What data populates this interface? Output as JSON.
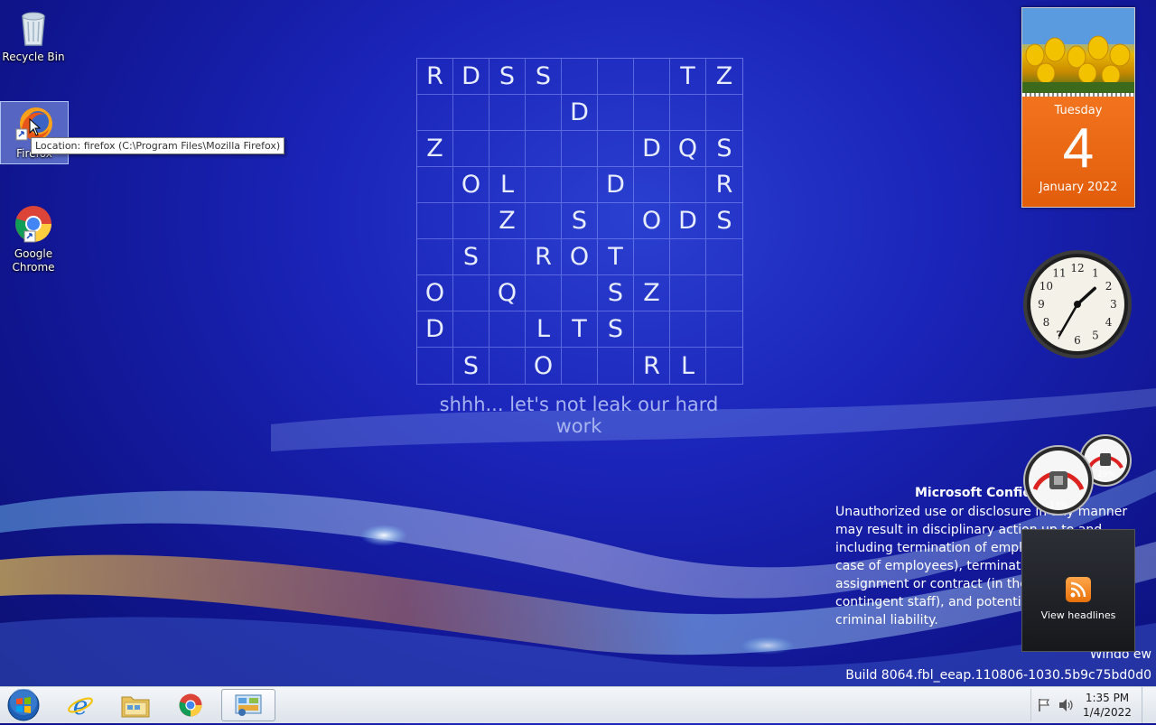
{
  "desktop": {
    "icons": [
      {
        "label": "Recycle Bin"
      },
      {
        "label": "Firefox"
      },
      {
        "label": "Google Chrome"
      }
    ],
    "tooltip": "Location: firefox (C:\\Program Files\\Mozilla Firefox)"
  },
  "wallpaper": {
    "grid_rows": [
      [
        "R",
        "D",
        "S",
        "S",
        "",
        "",
        "",
        "T",
        "Z"
      ],
      [
        "",
        "",
        "",
        "",
        "D",
        "",
        "",
        "",
        ""
      ],
      [
        "Z",
        "",
        "",
        "",
        "",
        "",
        "D",
        "Q",
        "S"
      ],
      [
        "",
        "O",
        "L",
        "",
        "",
        "D",
        "",
        "",
        "R"
      ],
      [
        "",
        "",
        "Z",
        "",
        "S",
        "",
        "O",
        "D",
        "S"
      ],
      [
        "",
        "S",
        "",
        "R",
        "O",
        "T",
        "",
        "",
        ""
      ],
      [
        "O",
        "",
        "Q",
        "",
        "",
        "S",
        "Z",
        "",
        ""
      ],
      [
        "D",
        "",
        "",
        "L",
        "T",
        "S",
        "",
        "",
        ""
      ],
      [
        "",
        "S",
        "",
        "O",
        "",
        "",
        "R",
        "L",
        ""
      ]
    ],
    "caption": "shhh... let's not leak our hard work"
  },
  "gadgets": {
    "calendar": {
      "weekday": "Tuesday",
      "day": "4",
      "month_year": "January 2022"
    },
    "clock": {
      "hour": 1,
      "minute": 35,
      "numerals": [
        "12",
        "1",
        "2",
        "3",
        "4",
        "5",
        "6",
        "7",
        "8",
        "9",
        "10",
        "11"
      ]
    },
    "meters": {
      "cpu": "13%",
      "memory": "29%"
    },
    "feed": {
      "label": "View headlines"
    }
  },
  "watermark": {
    "title": "Microsoft Confid",
    "body": "Unauthorized use or disclosure in any manner may result in disciplinary action up to and including termination of employment (in the case of employees), termination of an assignment or contract (in the case of contingent staff), and potential civil and criminal liability.",
    "line1": "Windo                          ew",
    "line2": "Build 8064.fbl_eeap.110806-1030.5b9c75bd0d0"
  },
  "taskbar": {
    "clock_time": "1:35 PM",
    "clock_date": "1/4/2022"
  }
}
